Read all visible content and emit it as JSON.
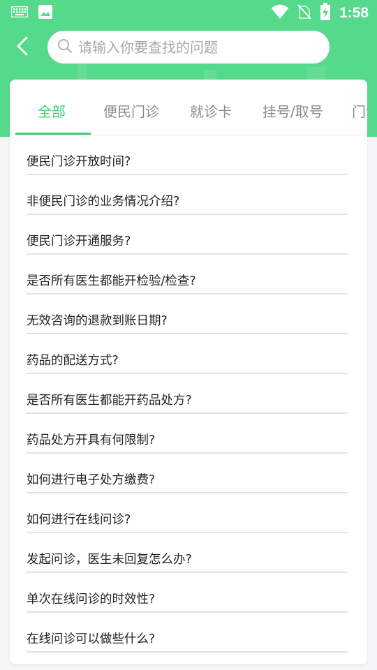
{
  "status_bar": {
    "time": "1:58",
    "icons": [
      "keyboard-icon",
      "image-icon",
      "wifi-icon",
      "no-sim-icon",
      "battery-charging-icon"
    ]
  },
  "header": {
    "back_icon": "chevron-left-icon",
    "search": {
      "placeholder": "请输入你要查找的问题",
      "value": ""
    }
  },
  "tabs": [
    {
      "label": "全部",
      "active": true
    },
    {
      "label": "便民门诊",
      "active": false
    },
    {
      "label": "就诊卡",
      "active": false
    },
    {
      "label": "挂号/取号",
      "active": false
    },
    {
      "label": "门诊",
      "active": false
    }
  ],
  "questions": [
    "便民门诊开放时间?",
    "非便民门诊的业务情况介绍?",
    "便民门诊开通服务?",
    "是否所有医生都能开检验/检查?",
    "无效咨询的退款到账日期?",
    "药品的配送方式?",
    "是否所有医生都能开药品处方?",
    "药品处方开具有何限制?",
    "如何进行电子处方缴费?",
    "如何进行在线问诊?",
    "发起问诊，医生未回复怎么办?",
    "单次在线问诊的时效性?",
    "在线问诊可以做些什么?"
  ],
  "colors": {
    "header_green": "#55d98a",
    "accent_green": "#3fcf77",
    "text_dark": "#222222",
    "text_gray": "#8a8a8a"
  }
}
